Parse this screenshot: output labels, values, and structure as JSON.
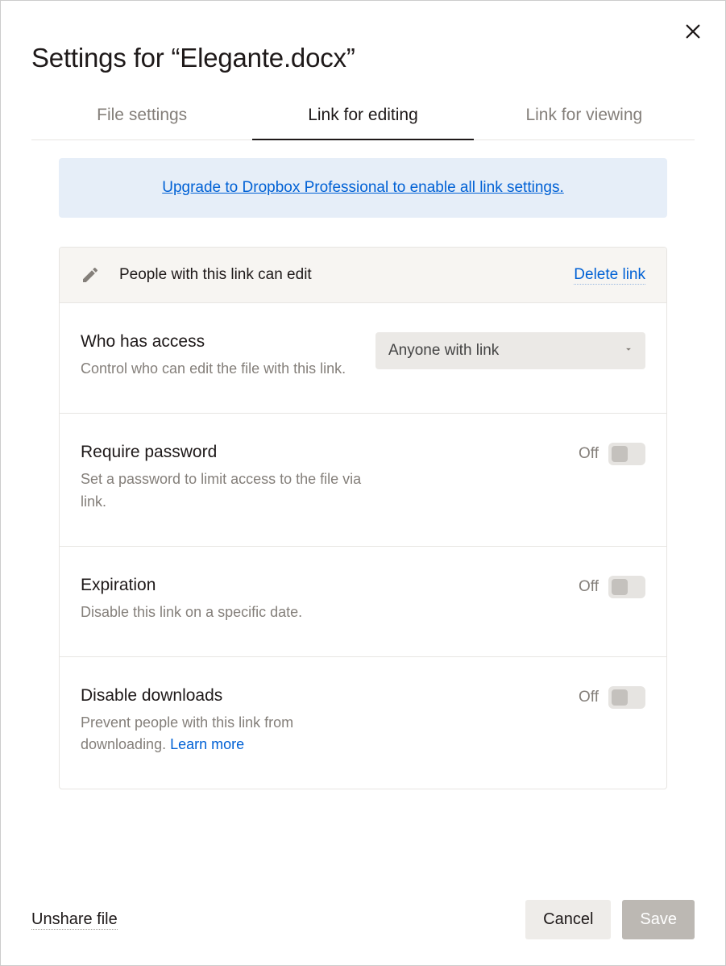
{
  "title": "Settings for “Elegante.docx”",
  "tabs": {
    "file_settings": "File settings",
    "link_editing": "Link for editing",
    "link_viewing": "Link for viewing"
  },
  "banner": {
    "text": "Upgrade to Dropbox Professional to enable all link settings."
  },
  "header": {
    "text": "People with this link can edit",
    "delete": "Delete link"
  },
  "access": {
    "title": "Who has access",
    "desc": "Control who can edit the file with this link.",
    "selected": "Anyone with link"
  },
  "password": {
    "title": "Require password",
    "desc": "Set a password to limit access to the file via link.",
    "state": "Off"
  },
  "expiration": {
    "title": "Expiration",
    "desc": "Disable this link on a specific date.",
    "state": "Off"
  },
  "downloads": {
    "title": "Disable downloads",
    "desc_prefix": "Prevent people with this link from downloading. ",
    "learn_more": "Learn more",
    "state": "Off"
  },
  "footer": {
    "unshare": "Unshare file",
    "cancel": "Cancel",
    "save": "Save"
  }
}
